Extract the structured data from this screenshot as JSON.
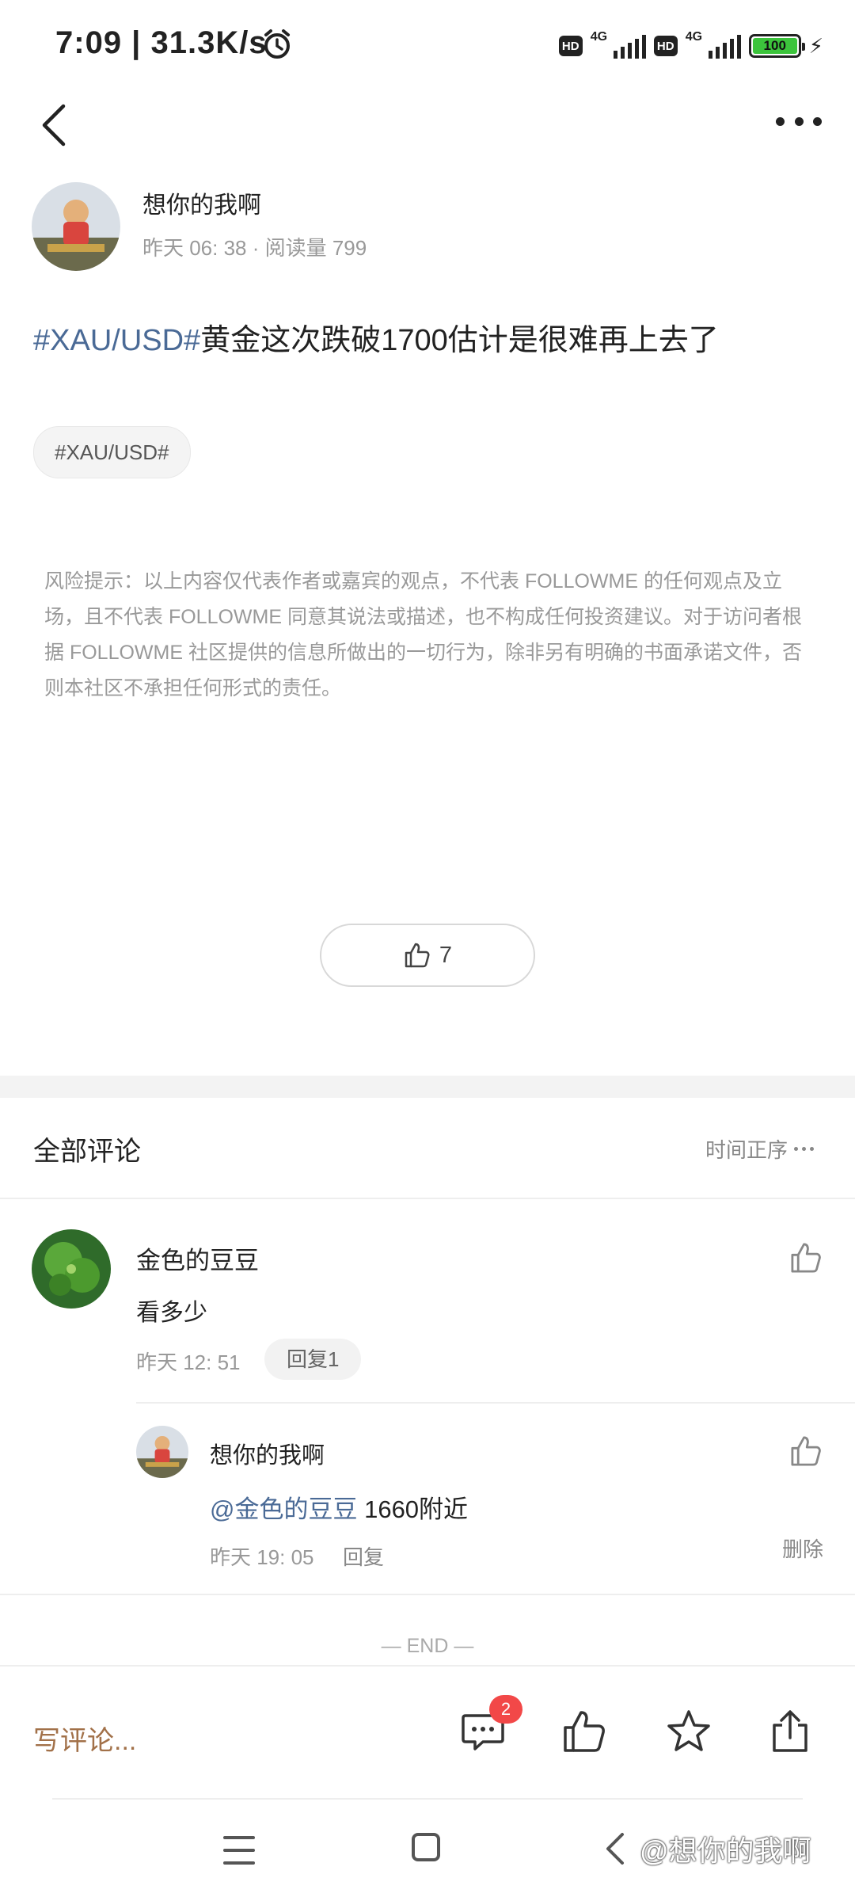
{
  "status_bar": {
    "time": "7:09 | 31.3K/s",
    "hd_label": "HD",
    "network_label": "4G",
    "battery": "100"
  },
  "post": {
    "author_name": "想你的我啊",
    "meta": "昨天 06: 38 · 阅读量 799",
    "title_tag": "#XAU/USD#",
    "title_text": "黄金这次跌破1700估计是很难再上去了",
    "topic_chip": "#XAU/USD#",
    "disclaimer": "风险提示：以上内容仅代表作者或嘉宾的观点，不代表 FOLLOWME 的任何观点及立场，且不代表 FOLLOWME 同意其说法或描述，也不构成任何投资建议。对于访问者根据 FOLLOWME 社区提供的信息所做出的一切行为，除非另有明确的书面承诺文件，否则本社区不承担任何形式的责任。",
    "like_count": "7"
  },
  "comments": {
    "title": "全部评论",
    "sort_label": "时间正序",
    "items": [
      {
        "author": "金色的豆豆",
        "text": "看多少",
        "time": "昨天 12: 51",
        "reply_chip": "回复1",
        "replies": [
          {
            "author": "想你的我啊",
            "mention": "@金色的豆豆",
            "text": " 1660附近",
            "time": "昨天 19: 05",
            "reply_label": "回复",
            "delete_label": "删除"
          }
        ]
      }
    ],
    "end_label": "— END —"
  },
  "action_bar": {
    "write_placeholder": "写评论...",
    "comment_badge": "2"
  },
  "watermark": "@想你的我啊",
  "colors": {
    "link": "#4a6a96",
    "write_comment": "#a27149",
    "badge": "#f24848",
    "battery_fill": "#3cc43c"
  },
  "icons": [
    "back-icon",
    "more-icon",
    "thumbs-up-icon",
    "comment-icon",
    "star-icon",
    "share-icon",
    "alarm-icon",
    "menu-icon",
    "home-icon",
    "nav-back-icon"
  ]
}
